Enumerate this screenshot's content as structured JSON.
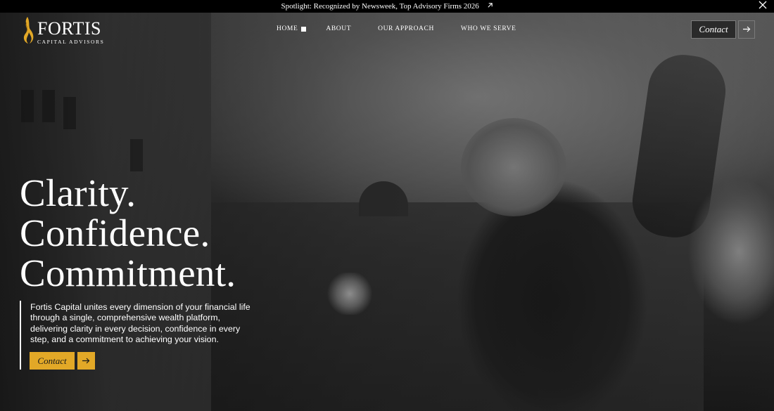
{
  "spotlight": {
    "text": "Spotlight: Recognized by Newsweek, Top Advisory Firms 2026",
    "link_icon": "arrow-up-right-icon",
    "close_icon": "close-icon"
  },
  "brand": {
    "name": "FORTIS",
    "tagline": "CAPITAL ADVISORS",
    "logo_icon": "flame-icon",
    "accent_color": "#e2a827"
  },
  "nav": {
    "items": [
      {
        "label": "HOME",
        "active": true
      },
      {
        "label": "ABOUT",
        "active": false
      },
      {
        "label": "OUR APPROACH",
        "active": false
      },
      {
        "label": "WHO WE SERVE",
        "active": false
      }
    ],
    "contact_label": "Contact",
    "contact_arrow_icon": "arrow-right-icon"
  },
  "hero": {
    "headline": [
      "Clarity.",
      "Confidence.",
      "Commitment."
    ],
    "intro": "Fortis Capital unites every dimension of your financial life through a single, comprehensive wealth platform, delivering clarity in every decision, confidence in every step, and a commitment to achieving your vision.",
    "cta_label": "Contact",
    "cta_arrow_icon": "arrow-right-icon"
  }
}
